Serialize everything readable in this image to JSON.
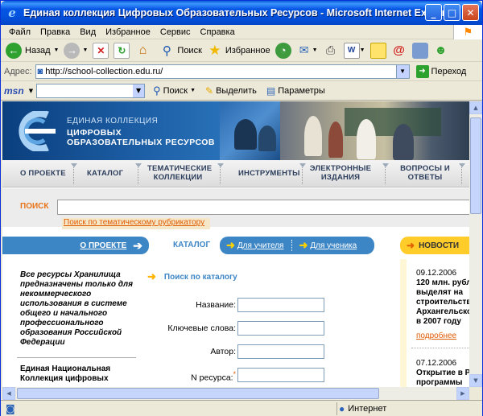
{
  "window": {
    "title": "Единая коллекция Цифровых Образовательных Ресурсов - Microsoft Internet Explorer",
    "minimize": "_",
    "maximize": "□",
    "close": "✕"
  },
  "menu": [
    "Файл",
    "Правка",
    "Вид",
    "Избранное",
    "Сервис",
    "Справка"
  ],
  "toolbar": {
    "back_label": "Назад",
    "search_label": "Поиск",
    "favorites_label": "Избранное"
  },
  "address": {
    "label": "Адрес:",
    "url": "http://school-collection.edu.ru/",
    "go_label": "Переход"
  },
  "msn": {
    "logo": "msn",
    "search_label": "Поиск",
    "highlight_label": "Выделить",
    "options_label": "Параметры"
  },
  "banner": {
    "line1": "ЕДИНАЯ КОЛЛЕКЦИЯ",
    "line2": "ЦИФРОВЫХ",
    "line3": "ОБРАЗОВАТЕЛЬНЫХ РЕСУРСОВ"
  },
  "nav": [
    {
      "label": "О ПРОЕКТЕ"
    },
    {
      "label": "КАТАЛОГ"
    },
    {
      "label": "ТЕМАТИЧЕСКИЕ КОЛЛЕКЦИИ"
    },
    {
      "label": "ИНСТРУМЕНТЫ"
    },
    {
      "label": "ЭЛЕКТРОННЫЕ ИЗДАНИЯ"
    },
    {
      "label": "ВОПРОСЫ И ОТВЕТЫ"
    }
  ],
  "search": {
    "label": "ПОИСК",
    "rubricator_link": "Поиск по тематическому рубрикатору"
  },
  "tabs": {
    "about": "О ПРОЕКТЕ",
    "catalog": "КАТАЛОГ",
    "for_teacher": "Для учителя",
    "for_student": "Для ученика",
    "news": "НОВОСТИ"
  },
  "left": {
    "disclaimer": "Все ресурсы Хранилища предназначены только для некоммерческого использования в системе общего и начального профессионального образования Российской Федерации",
    "collection_heading": "Единая Национальная Коллекция цифровых"
  },
  "form": {
    "title": "Поиск по каталогу",
    "fields": [
      {
        "label": "Название:",
        "value": "",
        "required": false
      },
      {
        "label": "Ключевые слова:",
        "value": "",
        "required": false
      },
      {
        "label": "Автор:",
        "value": "",
        "required": false
      },
      {
        "label": "N ресурса:",
        "value": "",
        "required": true
      }
    ],
    "required_mark": "*"
  },
  "news": [
    {
      "date": "09.12.2006",
      "headline": [
        "120 млн. рубл",
        "выделят на",
        "строительств",
        "Архангельско",
        "в 2007 году"
      ],
      "more": "подробнее"
    },
    {
      "date": "07.12.2006",
      "headline": [
        "Открытие в Р",
        "программы"
      ]
    }
  ],
  "status": {
    "zone": "Интернет"
  }
}
